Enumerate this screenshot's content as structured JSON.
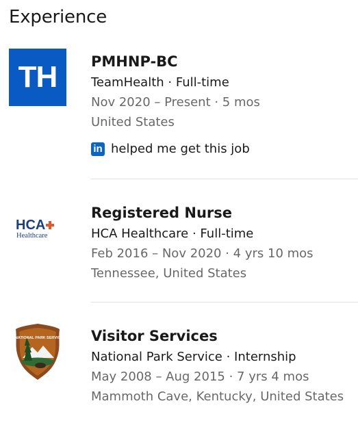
{
  "section": {
    "title": "Experience"
  },
  "colors": {
    "teamhealth_blue": "#0a5ac3",
    "linkedin_blue": "#0a66c2",
    "hca_orange": "#e05a2b",
    "hca_navy": "#1c3f7a",
    "nps_brown": "#8b4a1f"
  },
  "experiences": [
    {
      "logo_icon": "teamhealth-logo",
      "logo_text": "TH",
      "title": "PMHNP-BC",
      "company": "TeamHealth · Full-time",
      "dates": "Nov 2020 – Present · 5 mos",
      "location": "United States",
      "linkedin_badge": "in",
      "linkedin_note": "helped me get this job"
    },
    {
      "logo_icon": "hca-healthcare-logo",
      "logo_text": "HCA",
      "logo_subtext": "Healthcare",
      "title": "Registered Nurse",
      "company": "HCA Healthcare · Full-time",
      "dates": "Feb 2016 – Nov 2020 · 4 yrs 10 mos",
      "location": "Tennessee, United States"
    },
    {
      "logo_icon": "national-park-service-logo",
      "logo_text": "NATIONAL PARK SERVICE",
      "title": "Visitor Services",
      "company": "National Park Service · Internship",
      "dates": "May 2008 – Aug 2015 · 7 yrs 4 mos",
      "location": "Mammoth Cave, Kentucky, United States"
    }
  ]
}
